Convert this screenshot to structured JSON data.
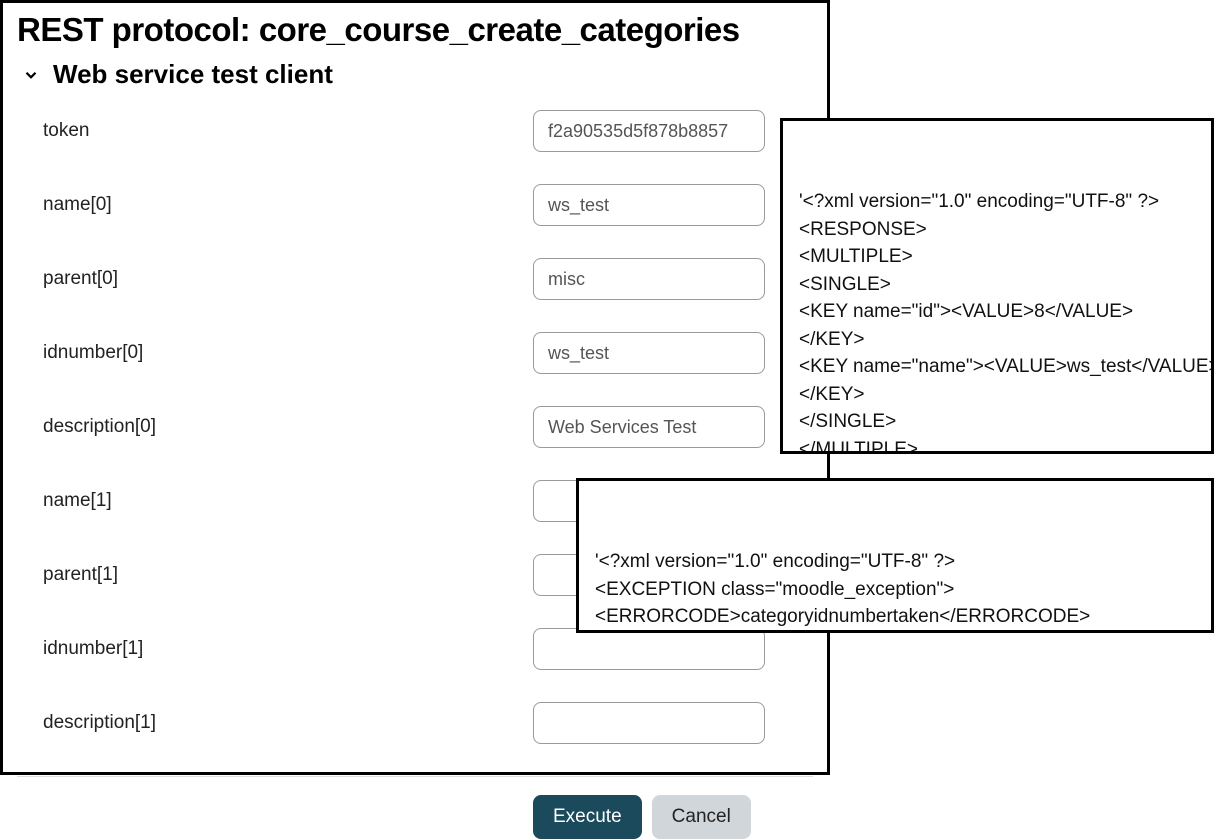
{
  "header": {
    "title": "REST protocol: core_course_create_categories",
    "section_title": "Web service test client"
  },
  "form": {
    "fields": [
      {
        "label": "token",
        "value": "f2a90535d5f878b8857"
      },
      {
        "label": "name[0]",
        "value": "ws_test"
      },
      {
        "label": "parent[0]",
        "value": "misc"
      },
      {
        "label": "idnumber[0]",
        "value": "ws_test"
      },
      {
        "label": "description[0]",
        "value": "Web Services Test"
      },
      {
        "label": "name[1]",
        "value": ""
      },
      {
        "label": "parent[1]",
        "value": ""
      },
      {
        "label": "idnumber[1]",
        "value": ""
      },
      {
        "label": "description[1]",
        "value": ""
      }
    ],
    "buttons": {
      "execute": "Execute",
      "cancel": "Cancel"
    }
  },
  "responses": {
    "success": "'<?xml version=\"1.0\" encoding=\"UTF-8\" ?>\n<RESPONSE>\n<MULTIPLE>\n<SINGLE>\n<KEY name=\"id\"><VALUE>8</VALUE>\n</KEY>\n<KEY name=\"name\"><VALUE>ws_test</VALUE>\n</KEY>\n</SINGLE>\n</MULTIPLE>\n</RESPONSE>\n'",
    "error": "'<?xml version=\"1.0\" encoding=\"UTF-8\" ?>\n<EXCEPTION class=\"moodle_exception\">\n<ERRORCODE>categoryidnumbertaken</ERRORCODE>\n<MESSAGE>ID number is already used for another category</MESSAGE>\n</EXCEPTION>\n'"
  }
}
